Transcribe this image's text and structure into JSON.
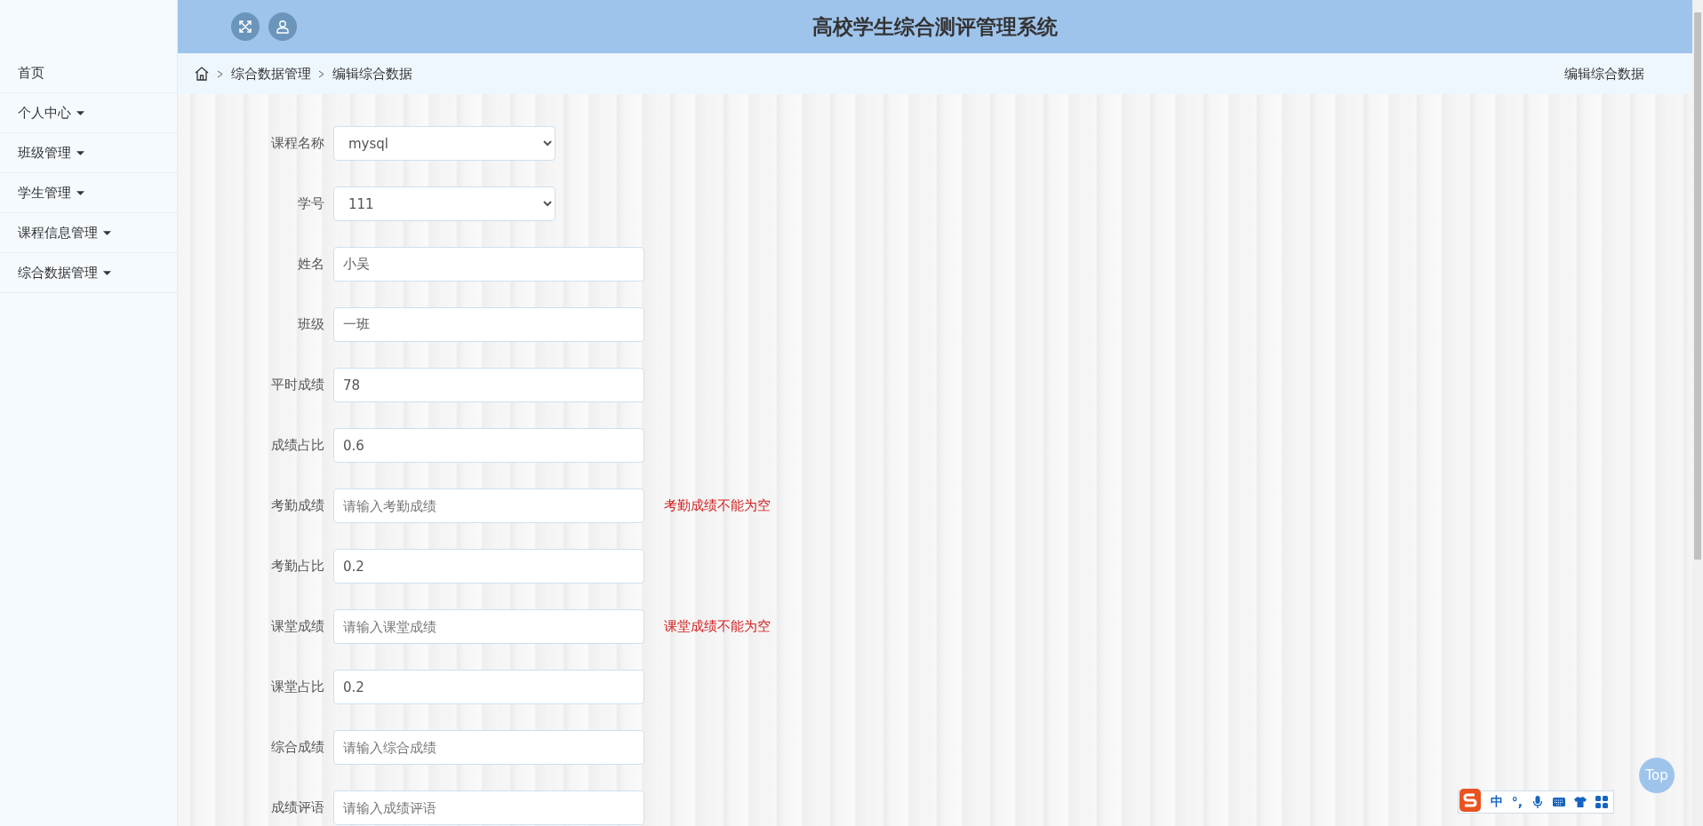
{
  "header": {
    "title": "高校学生综合测评管理系统"
  },
  "sidebar": {
    "items": [
      {
        "label": "首页",
        "has_caret": false
      },
      {
        "label": "个人中心",
        "has_caret": true
      },
      {
        "label": "班级管理",
        "has_caret": true
      },
      {
        "label": "学生管理",
        "has_caret": true
      },
      {
        "label": "课程信息管理",
        "has_caret": true
      },
      {
        "label": "综合数据管理",
        "has_caret": true
      }
    ]
  },
  "breadcrumb": {
    "items": [
      "综合数据管理",
      "编辑综合数据"
    ],
    "page_title": "编辑综合数据"
  },
  "form": {
    "fields": [
      {
        "kind": "select",
        "label": "课程名称",
        "value": "mysql"
      },
      {
        "kind": "select",
        "label": "学号",
        "value": "111"
      },
      {
        "kind": "input",
        "label": "姓名",
        "value": "小吴"
      },
      {
        "kind": "input",
        "label": "班级",
        "value": "一班"
      },
      {
        "kind": "input",
        "label": "平时成绩",
        "value": "78"
      },
      {
        "kind": "input",
        "label": "成绩占比",
        "value": "0.6"
      },
      {
        "kind": "input",
        "label": "考勤成绩",
        "placeholder": "请输入考勤成绩",
        "error": "考勤成绩不能为空"
      },
      {
        "kind": "input",
        "label": "考勤占比",
        "value": "0.2"
      },
      {
        "kind": "input",
        "label": "课堂成绩",
        "placeholder": "请输入课堂成绩",
        "error": "课堂成绩不能为空"
      },
      {
        "kind": "input",
        "label": "课堂占比",
        "value": "0.2"
      },
      {
        "kind": "input",
        "label": "综合成绩",
        "placeholder": "请输入综合成绩"
      },
      {
        "kind": "input",
        "label": "成绩评语",
        "placeholder": "请输入成绩评语"
      }
    ]
  },
  "back_to_top": "Top",
  "ime_toolbar": {
    "mode": "中",
    "punctuation": "°,"
  }
}
